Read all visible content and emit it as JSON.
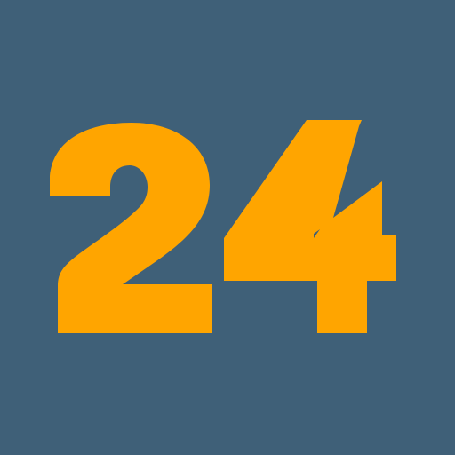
{
  "logo": {
    "text": "24",
    "background_color": "#3F6078",
    "text_color": "#FFA500"
  }
}
